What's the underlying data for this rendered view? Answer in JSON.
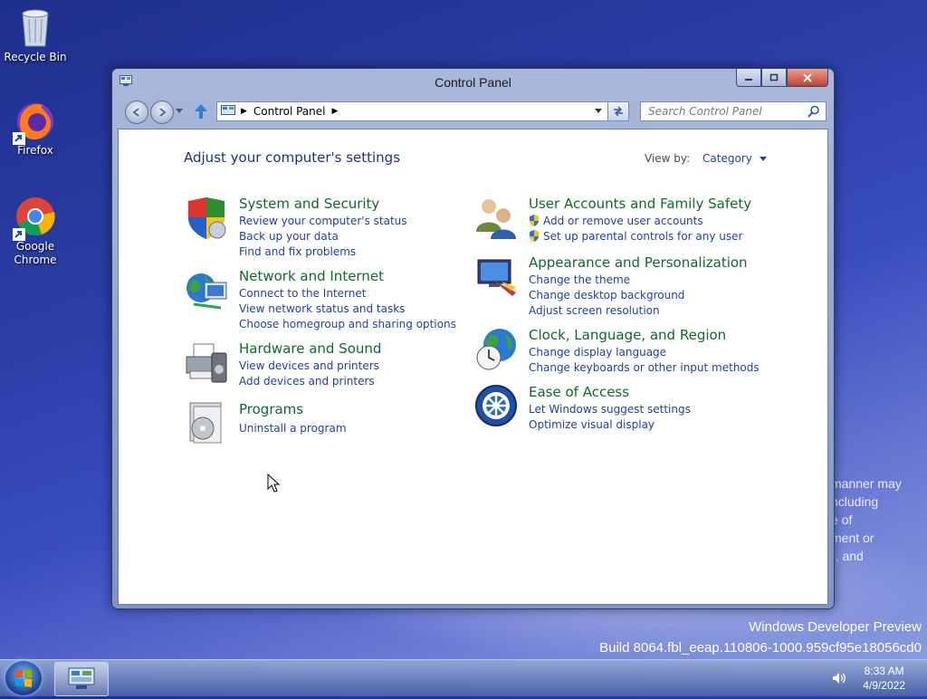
{
  "desktop": {
    "icons": [
      {
        "label": "Recycle Bin"
      },
      {
        "label": "Firefox"
      },
      {
        "label": "Google Chrome"
      }
    ],
    "background_text": [
      "manner may",
      "ncluding",
      "e of",
      "ment or",
      "), and"
    ],
    "watermark_line1": "Windows Developer Preview",
    "watermark_line2": "Build 8064.fbl_eeap.110806-1000.959cf95e18056cd0"
  },
  "window": {
    "title": "Control Panel",
    "address_path": "Control Panel",
    "search_placeholder": "Search Control Panel",
    "heading": "Adjust your computer's settings",
    "view_by_label": "View by:",
    "view_by_value": "Category",
    "categories_left": [
      {
        "title": "System and Security",
        "icon": "shield-icon",
        "links": [
          "Review your computer's status",
          "Back up your data",
          "Find and fix problems"
        ]
      },
      {
        "title": "Network and Internet",
        "icon": "network-globe-icon",
        "links": [
          "Connect to the Internet",
          "View network status and tasks",
          "Choose homegroup and sharing options"
        ]
      },
      {
        "title": "Hardware and Sound",
        "icon": "printer-icon",
        "links": [
          "View devices and printers",
          "Add devices and printers"
        ]
      },
      {
        "title": "Programs",
        "icon": "programs-disc-icon",
        "links": [
          "Uninstall a program"
        ]
      }
    ],
    "categories_right": [
      {
        "title": "User Accounts and Family Safety",
        "icon": "users-icon",
        "links": [
          "Add or remove user accounts",
          "Set up parental controls for any user"
        ]
      },
      {
        "title": "Appearance and Personalization",
        "icon": "monitor-paint-icon",
        "links": [
          "Change the theme",
          "Change desktop background",
          "Adjust screen resolution"
        ]
      },
      {
        "title": "Clock, Language, and Region",
        "icon": "globe-clock-icon",
        "links": [
          "Change display language",
          "Change keyboards or other input methods"
        ]
      },
      {
        "title": "Ease of Access",
        "icon": "ease-of-access-icon",
        "links": [
          "Let Windows suggest settings",
          "Optimize visual display"
        ]
      }
    ]
  },
  "taskbar": {
    "time": "8:33 AM",
    "date": "4/9/2022"
  },
  "colors": {
    "category_title": "#0e6b2a",
    "link": "#1e3fb0",
    "heading": "#1e3287"
  }
}
